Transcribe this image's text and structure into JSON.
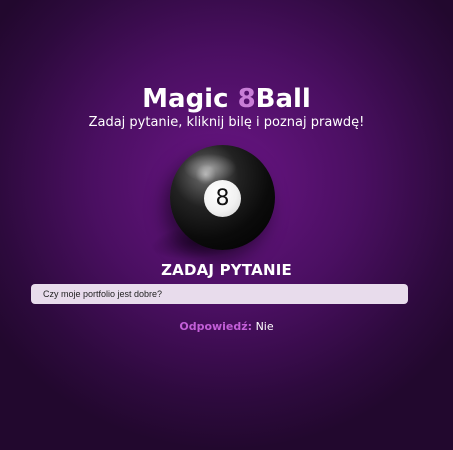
{
  "header": {
    "title_part1": "Magic ",
    "title_accent": "8",
    "title_part2": "Ball",
    "subtitle": "Zadaj pytanie, kliknij bilę i poznaj prawdę!"
  },
  "ball": {
    "number": "8",
    "icon": "eight-ball-icon"
  },
  "prompt": {
    "heading": "ZADAJ PYTANIE"
  },
  "question": {
    "value": "Czy moje portfolio jest dobre?"
  },
  "answer": {
    "label": "Odpowiedź:",
    "value": "Nie"
  },
  "colors": {
    "background": "#4a0f61",
    "accent": "#c87ed6",
    "answer_label": "#c35fd8",
    "input_background": "#e8dcec"
  }
}
